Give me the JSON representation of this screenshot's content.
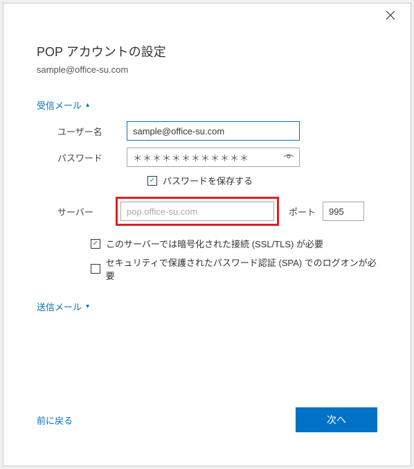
{
  "title": "POP アカウントの設定",
  "email": "sample@office-su.com",
  "incoming": {
    "header": "受信メール",
    "username_label": "ユーザー名",
    "username_value": "sample@office-su.com",
    "password_label": "パスワード",
    "password_value": "＊＊＊＊＊＊＊＊＊＊＊＊",
    "save_password_label": "パスワードを保存する",
    "save_password_checked": "✓",
    "server_label": "サーバー",
    "server_value": "pop.office-su.com",
    "port_label": "ポート",
    "port_value": "995",
    "ssl_label": "このサーバーでは暗号化された接続 (SSL/TLS) が必要",
    "ssl_checked": "✓",
    "spa_label": "セキュリティで保護されたパスワード認証 (SPA) でのログオンが必要",
    "spa_checked": ""
  },
  "outgoing": {
    "header": "送信メール"
  },
  "footer": {
    "back": "前に戻る",
    "next": "次へ"
  }
}
